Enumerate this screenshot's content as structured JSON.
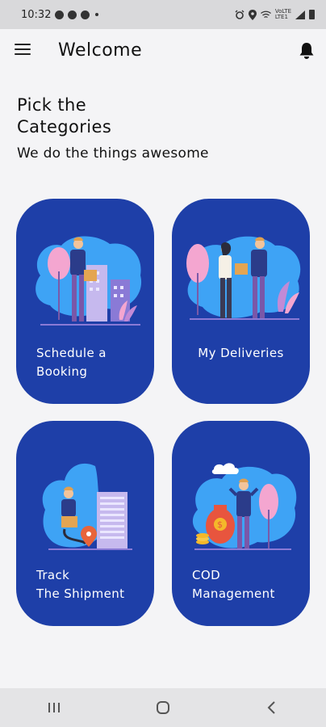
{
  "status_bar": {
    "time": "10:32",
    "network_label": "VoLTE",
    "network_label_2": "LTE1"
  },
  "app_bar": {
    "title": "Welcome",
    "menu_icon": "hamburger-menu-icon",
    "bell_icon": "notification-bell-icon"
  },
  "header": {
    "title": "Pick the\nCategories",
    "subtitle": "We do the things awesome"
  },
  "categories": [
    {
      "label": "Schedule a\nBooking"
    },
    {
      "label": "My Deliveries"
    },
    {
      "label": "Track\nThe Shipment"
    },
    {
      "label": "COD\nManagement"
    }
  ],
  "colors": {
    "card": "#1e3fa8",
    "accent_blob": "#3ea3f5",
    "pink": "#f4a6d0",
    "background": "#f4f4f6"
  }
}
